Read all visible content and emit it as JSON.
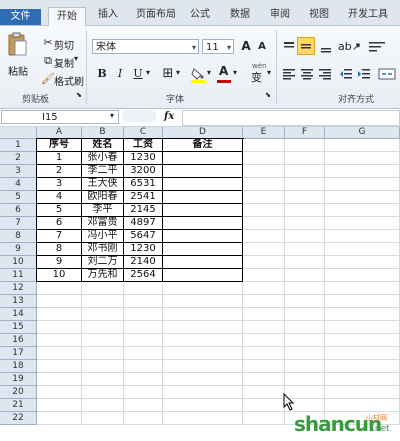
{
  "tabs": [
    "文件",
    "开始",
    "插入",
    "页面布局",
    "公式",
    "数据",
    "审阅",
    "视图",
    "开发工具"
  ],
  "clipboard": {
    "paste": "粘贴",
    "cut": "剪切",
    "copy": "复制",
    "format_painter": "格式刷",
    "group_label": "剪贴板"
  },
  "font": {
    "name": "宋体",
    "size": "11",
    "grow": "A",
    "shrink": "A",
    "bold": "B",
    "italic": "I",
    "underline": "U",
    "font_color_letter": "A",
    "wen": "wén",
    "wen_char": "变",
    "group_label": "字体",
    "font_color": "#c00000",
    "fill_color": "#ffff00"
  },
  "align": {
    "group_label": "对齐方式"
  },
  "formula_bar": {
    "name_box": "I15",
    "fx": "fx",
    "formula": ""
  },
  "columns": [
    "A",
    "B",
    "C",
    "D",
    "E",
    "F",
    "G"
  ],
  "rows": [
    "1",
    "2",
    "3",
    "4",
    "5",
    "6",
    "7",
    "8",
    "9",
    "10",
    "11",
    "12",
    "13",
    "14",
    "15",
    "16",
    "17",
    "18",
    "19",
    "20",
    "21",
    "22"
  ],
  "table": {
    "headers": [
      "序号",
      "姓名",
      "工资",
      "备注"
    ],
    "data": [
      [
        "1",
        "张小春",
        "1230",
        ""
      ],
      [
        "2",
        "李二平",
        "3200",
        ""
      ],
      [
        "3",
        "王大侠",
        "6531",
        ""
      ],
      [
        "4",
        "欧阳春",
        "2541",
        ""
      ],
      [
        "5",
        "李平",
        "2145",
        ""
      ],
      [
        "6",
        "邓富贵",
        "4897",
        ""
      ],
      [
        "7",
        "冯小平",
        "5647",
        ""
      ],
      [
        "8",
        "邓书刚",
        "1230",
        ""
      ],
      [
        "9",
        "刘二万",
        "2140",
        ""
      ],
      [
        "10",
        "万先和",
        "2564",
        ""
      ]
    ]
  },
  "watermark": {
    "main": "shancun",
    "sub": "山村网",
    "net": ".net"
  }
}
